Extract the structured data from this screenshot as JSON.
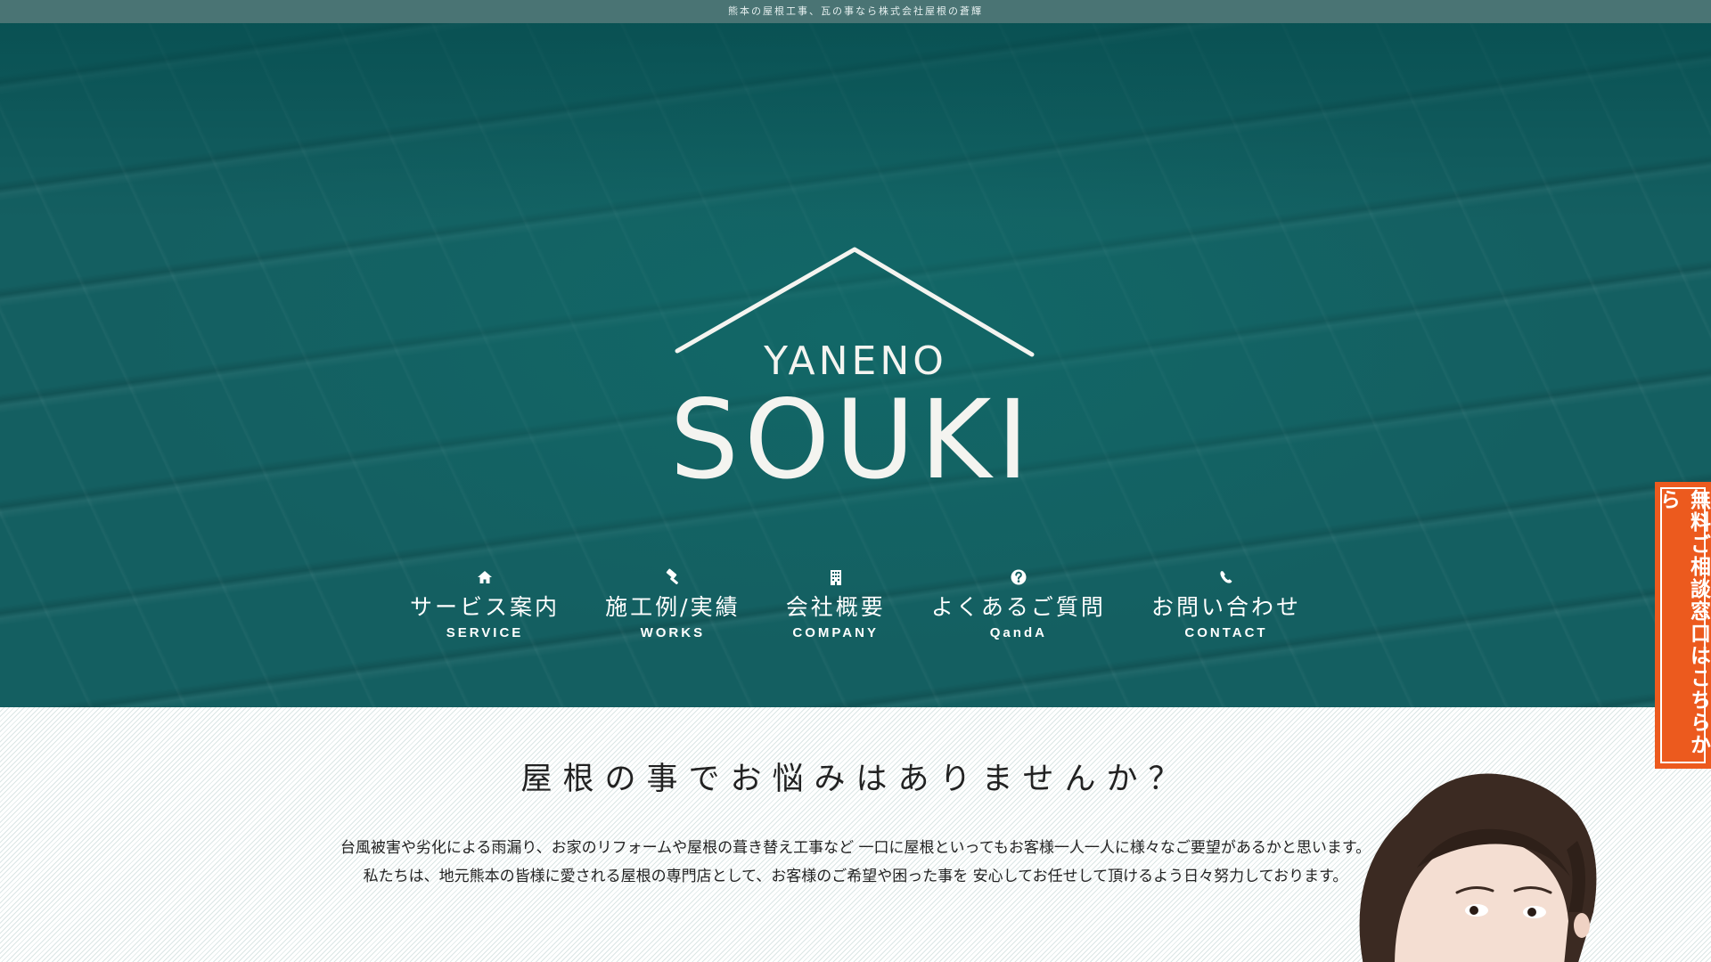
{
  "topbar": {
    "text": "熊本の屋根工事、瓦の事なら株式会社屋根の蒼輝"
  },
  "logo": {
    "line1": "YANENO",
    "line2": "SOUKI"
  },
  "nav": {
    "items": [
      {
        "label": "サービス案内",
        "sub": "SERVICE",
        "icon": "home-icon"
      },
      {
        "label": "施工例/実績",
        "sub": "WORKS",
        "icon": "hammer-icon"
      },
      {
        "label": "会社概要",
        "sub": "COMPANY",
        "icon": "building-icon"
      },
      {
        "label": "よくあるご質問",
        "sub": "QandA",
        "icon": "question-circle-icon"
      },
      {
        "label": "お問い合わせ",
        "sub": "CONTACT",
        "icon": "phone-icon"
      }
    ]
  },
  "intro": {
    "heading": "屋根の事でお悩みはありませんか？",
    "line1": "台風被害や劣化による雨漏り、お家のリフォームや屋根の葺き替え工事など 一口に屋根といってもお客様一人一人に様々なご要望があるかと思います。",
    "line2": "私たちは、地元熊本の皆様に愛される屋根の専門店として、お客様のご希望や困った事を 安心してお任せして頂けるよう日々努力しております。"
  },
  "side_tab": {
    "text": "無料ご相談窓口はこちらから"
  },
  "colors": {
    "topbar": "#4a7474",
    "hero": "#145f61",
    "accent": "#ec5a1e"
  }
}
